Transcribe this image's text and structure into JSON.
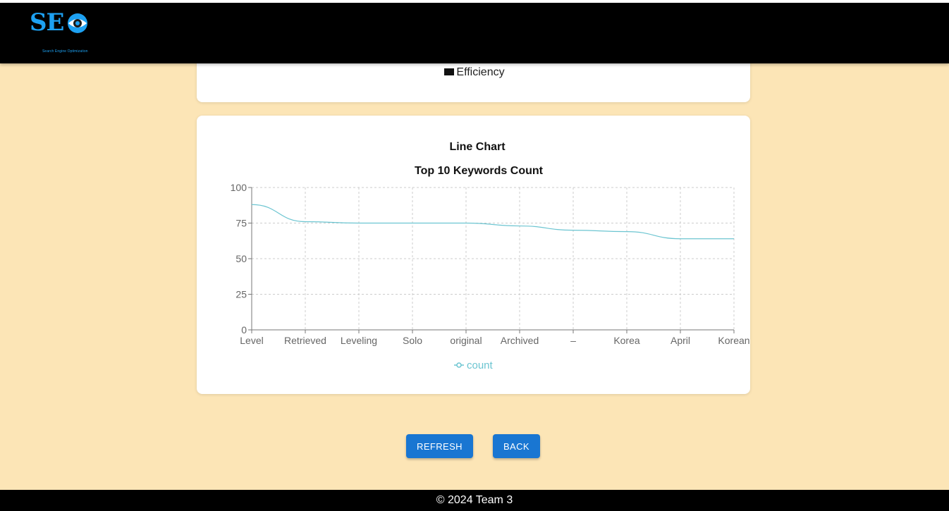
{
  "header": {
    "logo_text": "SE",
    "logo_tagline": "Search Engine Optimization"
  },
  "previous_chart": {
    "legend_label": "Efficiency",
    "legend_color": "#111111"
  },
  "chart_data": {
    "type": "line",
    "title": "Line Chart",
    "subtitle": "Top 10 Keywords Count",
    "categories": [
      "Level",
      "Retrieved",
      "Leveling",
      "Solo",
      "original",
      "Archived",
      "–",
      "Korea",
      "April",
      "Korean"
    ],
    "series": [
      {
        "name": "count",
        "values": [
          88,
          76,
          75,
          75,
          75,
          73,
          70,
          69,
          64,
          64
        ],
        "color": "#6cc5d1"
      }
    ],
    "ylim": [
      0,
      100
    ],
    "yticks": [
      "0",
      "25",
      "50",
      "75",
      "100"
    ],
    "grid": true,
    "legend_position": "bottom"
  },
  "buttons": {
    "refresh_label": "REFRESH",
    "back_label": "BACK",
    "color": "#1976d2"
  },
  "footer": {
    "text": "© 2024 Team 3"
  }
}
